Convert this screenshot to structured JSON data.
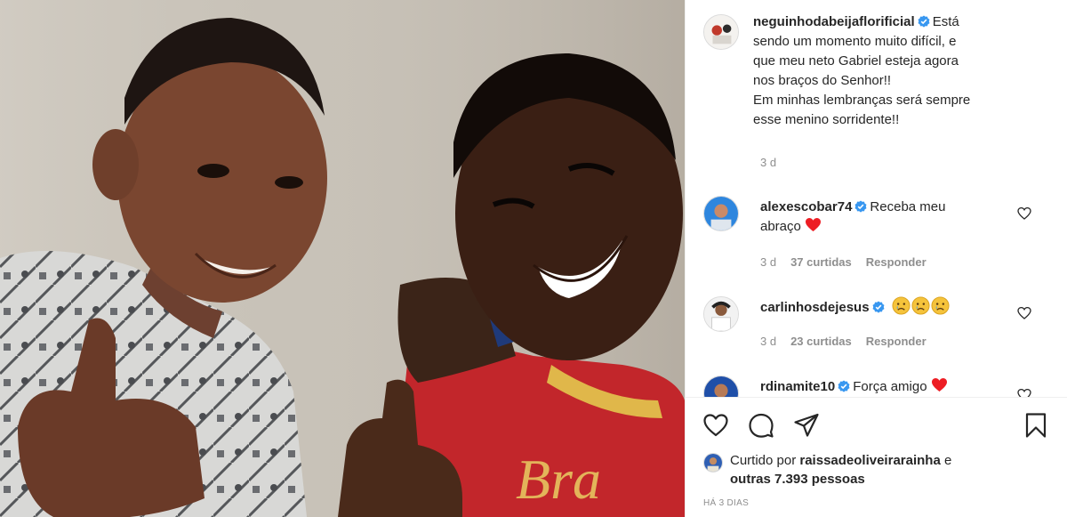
{
  "photo": {
    "description_alt": "",
    "shirt_text": "Bra"
  },
  "post": {
    "author": "neguinhodabeijaflorificial",
    "caption_first": "Está",
    "caption_lines": [
      "sendo um momento muito difícil, e",
      "que meu neto Gabriel esteja agora",
      "nos braços do Senhor!!",
      "Em minhas lembranças será sempre",
      "esse menino sorridente!!"
    ],
    "age": "3 d"
  },
  "comments": [
    {
      "username": "alexescobar74",
      "text_line1": "Receba meu",
      "text_line2": "abraço",
      "emoji": "red-heart",
      "age": "3 d",
      "likes": "37 curtidas",
      "reply": "Responder"
    },
    {
      "username": "carlinhosdejesus",
      "text_line1": "",
      "emoji": "crying-faces",
      "age": "3 d",
      "likes": "23 curtidas",
      "reply": "Responder"
    },
    {
      "username": "rdinamite10",
      "text_line1": "Força amigo",
      "emoji": "red-heart"
    }
  ],
  "likes": {
    "prefix": "Curtido por",
    "user": "raissadeoliveirarainha",
    "conj": "e",
    "others": "outras 7.393 pessoas"
  },
  "timestamp": "HÁ 3 DIAS",
  "colors": {
    "verified": "#3897f0",
    "heart": "#ed1d24",
    "muted": "#8e8e8e",
    "text": "#262626"
  }
}
